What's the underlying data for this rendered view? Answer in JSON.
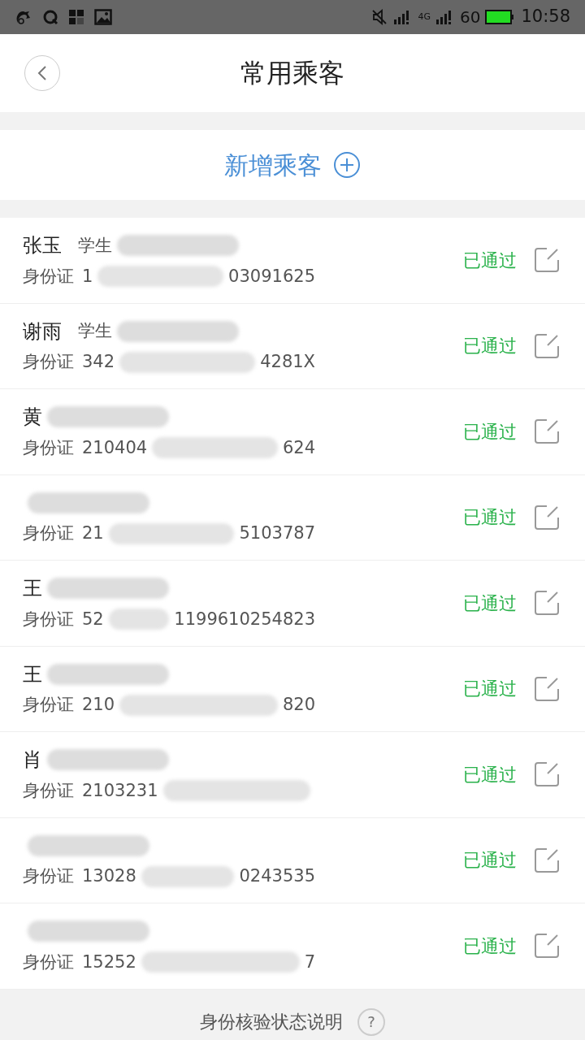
{
  "status_bar": {
    "network": "4G",
    "battery": "60",
    "time": "10:58"
  },
  "header": {
    "title": "常用乘客"
  },
  "add_button": {
    "label": "新增乘客"
  },
  "passengers": [
    {
      "name": "张玉",
      "type": "学生",
      "id_label": "身份证",
      "id_start": "1",
      "id_end": "03091625",
      "status": "已通过"
    },
    {
      "name": "谢雨",
      "type": "学生",
      "id_label": "身份证",
      "id_start": "342",
      "id_end": "4281X",
      "status": "已通过"
    },
    {
      "name": "黄",
      "id_label": "身份证",
      "id_start": "210404",
      "id_end": "624",
      "status": "已通过"
    },
    {
      "id_label": "身份证",
      "id_start": "21",
      "id_end": "5103787",
      "status": "已通过"
    },
    {
      "name": "王",
      "id_label": "身份证",
      "id_start": "52",
      "id_end": "1199610254823",
      "status": "已通过"
    },
    {
      "name": "王",
      "id_label": "身份证",
      "id_start": "210",
      "id_end": "820",
      "status": "已通过"
    },
    {
      "name": "肖",
      "id_label": "身份证",
      "id_start": "2103231",
      "status": "已通过"
    },
    {
      "id_label": "身份证",
      "id_start": "13028",
      "id_end": "0243535",
      "status": "已通过"
    },
    {
      "id_label": "身份证",
      "id_start": "15252",
      "id_end": "7",
      "status": "已通过"
    }
  ],
  "footer": {
    "label": "身份核验状态说明",
    "help": "?"
  }
}
